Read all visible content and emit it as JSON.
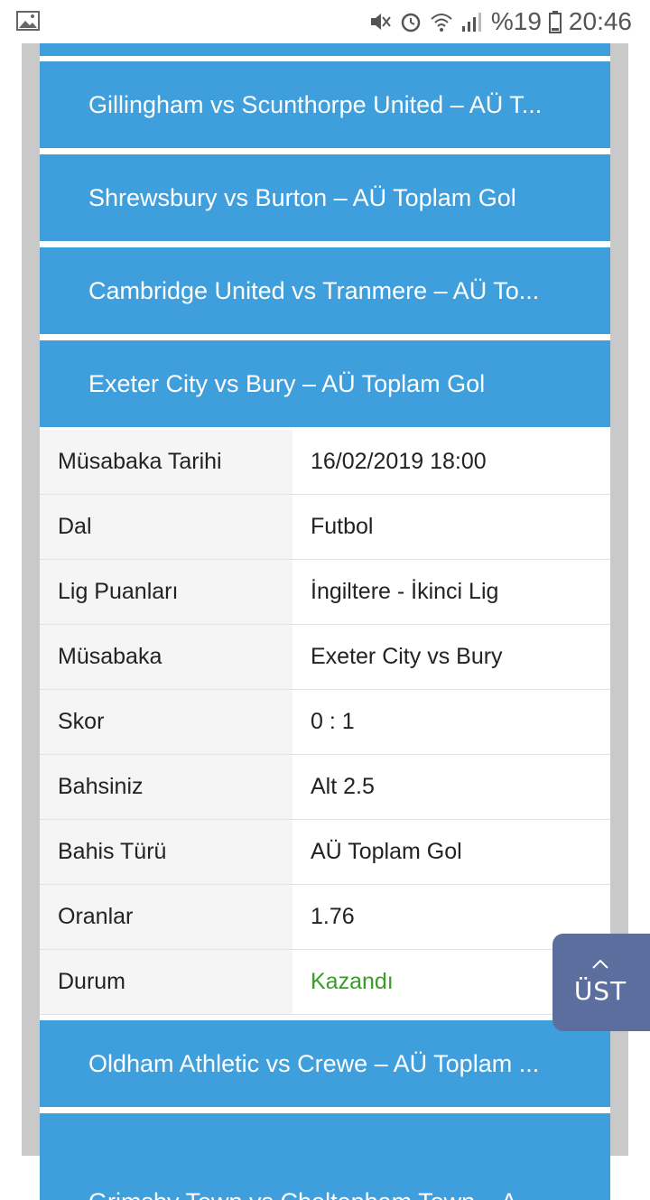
{
  "status_bar": {
    "battery": "%19",
    "time": "20:46",
    "icons": [
      "image-icon",
      "mute-icon",
      "alarm-icon",
      "wifi-icon",
      "signal-icon",
      "battery-icon"
    ]
  },
  "accordion_top": [
    {
      "label": "Gillingham vs Scunthorpe United – AÜ T..."
    },
    {
      "label": "Shrewsbury vs Burton – AÜ Toplam Gol"
    },
    {
      "label": "Cambridge United vs Tranmere – AÜ To..."
    },
    {
      "label": "Exeter City vs Bury – AÜ Toplam Gol"
    }
  ],
  "details": [
    {
      "key": "Müsabaka Tarihi",
      "value": "16/02/2019 18:00"
    },
    {
      "key": "Dal",
      "value": "Futbol"
    },
    {
      "key": "Lig Puanları",
      "value": "İngiltere - İkinci Lig"
    },
    {
      "key": "Müsabaka",
      "value": "Exeter City vs Bury"
    },
    {
      "key": "Skor",
      "value": "0 : 1"
    },
    {
      "key": "Bahsiniz",
      "value": "Alt 2.5"
    },
    {
      "key": "Bahis Türü",
      "value": "AÜ Toplam Gol"
    },
    {
      "key": "Oranlar",
      "value": "1.76"
    },
    {
      "key": "Durum",
      "value": "Kazandı"
    }
  ],
  "accordion_bottom": [
    {
      "label": "Oldham Athletic vs Crewe – AÜ Toplam ..."
    },
    {
      "label": "Grimsby Town vs Cheltenham Town – A..."
    }
  ],
  "scroll_top_button": {
    "label": "ÜST"
  },
  "colors": {
    "accordion": "#3e9fdc",
    "win": "#3a9a2a",
    "ust_button": "#5b6e9e"
  }
}
